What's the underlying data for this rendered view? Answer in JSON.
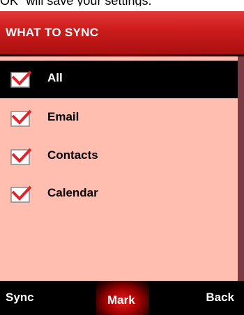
{
  "caption": "OK\" will save your settings.",
  "header": {
    "title": "WHAT TO SYNC"
  },
  "items": [
    {
      "label": "All",
      "checked": true,
      "selected": true
    },
    {
      "label": "Email",
      "checked": true,
      "selected": false
    },
    {
      "label": "Contacts",
      "checked": true,
      "selected": false
    },
    {
      "label": "Calendar",
      "checked": true,
      "selected": false
    }
  ],
  "softkeys": {
    "left": "Sync",
    "center": "Mark",
    "right": "Back"
  },
  "colors": {
    "header_red": "#cf1d1d",
    "list_bg": "#ffbeb0",
    "scrollbar": "#7b3b45",
    "check_red": "#e0242b"
  }
}
